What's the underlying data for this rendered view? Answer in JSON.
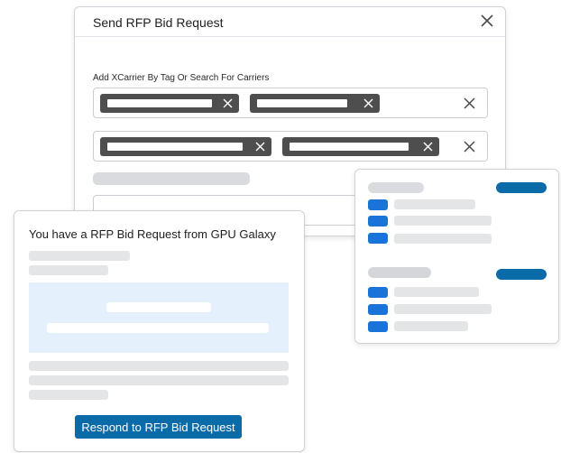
{
  "modal": {
    "title": "Send RFP Bid Request",
    "field_label": "Add XCarrier By Tag Or Search For Carriers"
  },
  "notification": {
    "title": "You have a RFP Bid Request from GPU Galaxy",
    "respond_button": "Respond to RFP Bid Request"
  },
  "colors": {
    "primary": "#0b6aa8",
    "checkbox": "#1a73d9",
    "tag_bg": "#4e4e4e",
    "preview_bg": "#e4f0fb",
    "skeleton": "#e4e5e7"
  },
  "icons": {
    "close": "close-icon",
    "tag_remove": "close-icon",
    "row_clear": "clear-icon"
  }
}
